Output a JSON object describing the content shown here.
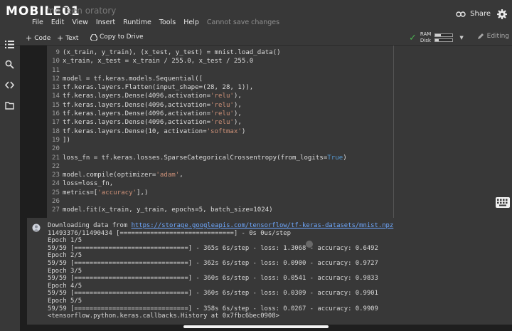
{
  "header": {
    "logo_text": "MOBILE01",
    "faint_title": "ime Teen oratory",
    "menu": [
      "File",
      "Edit",
      "View",
      "Insert",
      "Runtime",
      "Tools",
      "Help"
    ],
    "save_status": "Cannot save changes",
    "share_label": "Share"
  },
  "toolbar": {
    "code_label": "Code",
    "text_label": "Text",
    "copy_label": "Copy to Drive",
    "ram_label": "RAM",
    "disk_label": "Disk",
    "ram_fraction": 0.3,
    "disk_fraction": 0.2,
    "editing_label": "Editing"
  },
  "rail": {
    "icons": [
      "toc-icon",
      "search-icon",
      "code-snippets-icon",
      "files-icon"
    ]
  },
  "code_cell": {
    "lines": [
      {
        "n": "9",
        "t": "(x_train, y_train), (x_test, y_test) = mnist.load_data()"
      },
      {
        "n": "10",
        "t": "x_train, x_test = x_train / 255.0, x_test / 255.0"
      },
      {
        "n": "11",
        "t": ""
      },
      {
        "n": "12",
        "t": "model = tf.keras.models.Sequential(["
      },
      {
        "n": "13",
        "t": "tf.keras.layers.Flatten(input_shape=(28, 28, 1)),"
      },
      {
        "n": "14",
        "t": "tf.keras.layers.Dense(4096,activation='relu'),"
      },
      {
        "n": "15",
        "t": "tf.keras.layers.Dense(4096,activation='relu'),"
      },
      {
        "n": "16",
        "t": "tf.keras.layers.Dense(4096,activation='relu'),"
      },
      {
        "n": "17",
        "t": "tf.keras.layers.Dense(4096,activation='relu'),"
      },
      {
        "n": "18",
        "t": "tf.keras.layers.Dense(10, activation='softmax')"
      },
      {
        "n": "19",
        "t": "])"
      },
      {
        "n": "20",
        "t": ""
      },
      {
        "n": "21",
        "t": "loss_fn = tf.keras.losses.SparseCategoricalCrossentropy(from_logits=True)"
      },
      {
        "n": "22",
        "t": ""
      },
      {
        "n": "23",
        "t": "model.compile(optimizer='adam',"
      },
      {
        "n": "24",
        "t": "loss=loss_fn,"
      },
      {
        "n": "25",
        "t": "metrics=['accuracy'],)"
      },
      {
        "n": "26",
        "t": ""
      },
      {
        "n": "27",
        "t": "model.fit(x_train, y_train, epochs=5, batch_size=1024)"
      }
    ]
  },
  "output": {
    "download_prefix": "Downloading data from ",
    "download_url": "https://storage.googleapis.com/tensorflow/tf-keras-datasets/mnist.npz",
    "lines": [
      "11493376/11490434 [==============================] - 0s 0us/step",
      "Epoch 1/5",
      "59/59 [==============================] - 365s 6s/step - loss: 1.3068 - accuracy: 0.6492",
      "Epoch 2/5",
      "59/59 [==============================] - 362s 6s/step - loss: 0.0900 - accuracy: 0.9727",
      "Epoch 3/5",
      "59/59 [==============================] - 360s 6s/step - loss: 0.0541 - accuracy: 0.9833",
      "Epoch 4/5",
      "59/59 [==============================] - 360s 6s/step - loss: 0.0309 - accuracy: 0.9901",
      "Epoch 5/5",
      "59/59 [==============================] - 358s 6s/step - loss: 0.0267 - accuracy: 0.9909",
      "<tensorflow.python.keras.callbacks.History at 0x7fbc6bec0908>"
    ]
  },
  "colors": {
    "background": "#1e1e1e",
    "chrome": "#383838",
    "link": "#6ea8ff",
    "string": "#ce9178",
    "keyword": "#569cd6",
    "ok_check": "#4caf50"
  }
}
